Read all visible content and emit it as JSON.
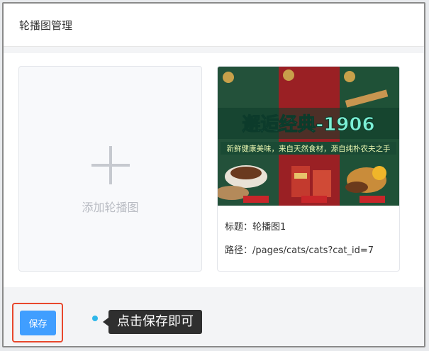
{
  "header": {
    "title": "轮播图管理"
  },
  "add_card": {
    "label": "添加轮播图",
    "icon": "plus-icon"
  },
  "banner": {
    "image": {
      "headline": "邂逅经典-1906",
      "tagline": "新鲜健康美味，来自天然食材，源自纯朴农夫之手"
    },
    "title_line": "标题：轮播图1",
    "path_line": "路径：/pages/cats/cats?cat_id=7"
  },
  "footer": {
    "save_label": "保存",
    "hint": "点击保存即可"
  },
  "colors": {
    "primary": "#409eff",
    "highlight": "#e8472c",
    "tooltip_bg": "#2f2f2f",
    "banner_green": "#1f5a3a",
    "banner_red": "#b0262a"
  }
}
